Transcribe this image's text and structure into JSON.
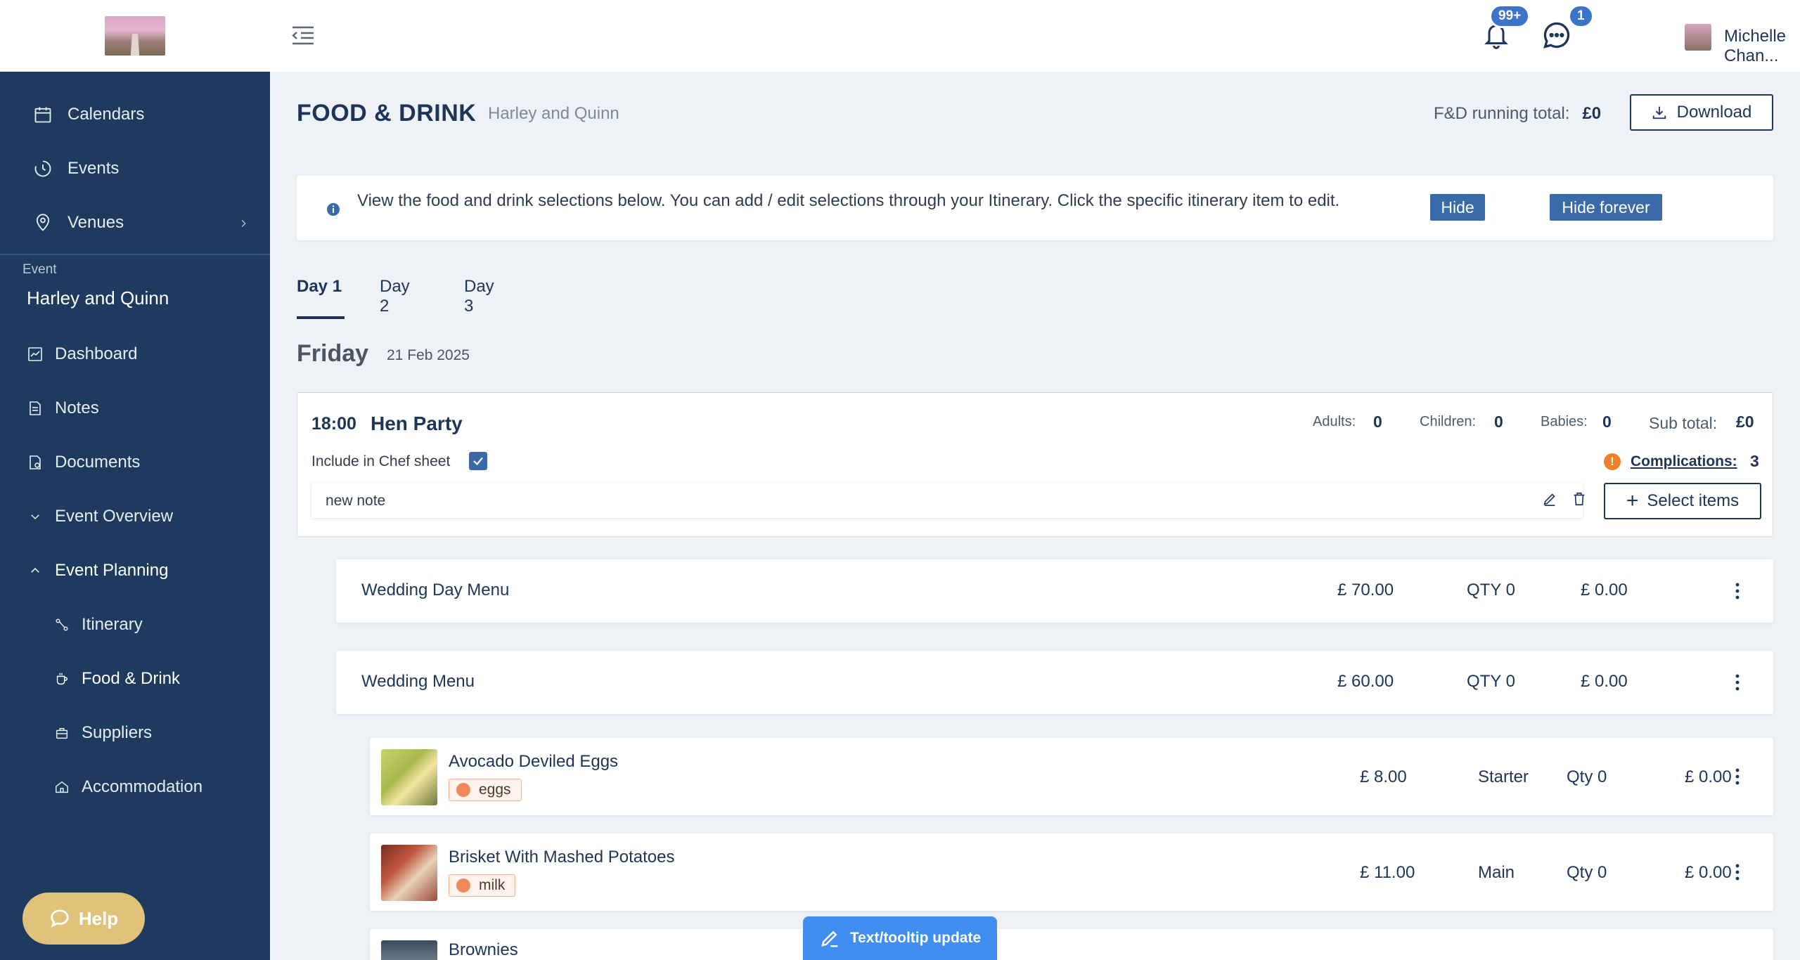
{
  "sidebar": {
    "nav": [
      {
        "label": "Calendars",
        "icon": "calendar-icon"
      },
      {
        "label": "Events",
        "icon": "history-icon"
      },
      {
        "label": "Venues",
        "icon": "location-pin-icon"
      }
    ],
    "event_label": "Event",
    "event_name": "Harley and Quinn",
    "event_nav": [
      {
        "label": "Dashboard"
      },
      {
        "label": "Notes"
      },
      {
        "label": "Documents"
      },
      {
        "label": "Event Overview"
      },
      {
        "label": "Event Planning"
      }
    ],
    "planning_sub": [
      {
        "label": "Itinerary"
      },
      {
        "label": "Food & Drink"
      },
      {
        "label": "Suppliers"
      },
      {
        "label": "Accommodation"
      }
    ],
    "help_label": "Help"
  },
  "topbar": {
    "notifications_badge": "99+",
    "messages_badge": "1",
    "username": "Michelle Chan..."
  },
  "page": {
    "title": "FOOD & DRINK",
    "subtitle": "Harley and Quinn",
    "running_total_label": "F&D running total:",
    "running_total_value": "£0",
    "download_label": "Download"
  },
  "info": {
    "text": "View the food and drink selections below. You can add / edit selections through your Itinerary. Click the specific itinerary item to edit.",
    "hide_label": "Hide",
    "hide_forever_label": "Hide forever"
  },
  "tabs": [
    "Day 1",
    "Day 2",
    "Day 3"
  ],
  "day": {
    "name": "Friday",
    "date": "21 Feb 2025"
  },
  "session": {
    "time": "18:00",
    "name": "Hen Party",
    "adults_label": "Adults:",
    "adults": "0",
    "children_label": "Children:",
    "children": "0",
    "babies_label": "Babies:",
    "babies": "0",
    "subtotal_label": "Sub total:",
    "subtotal": "£0",
    "chef_label": "Include in Chef sheet",
    "chef_checked": true,
    "complications_label": "Complications:",
    "complications": "3",
    "note": "new note",
    "select_label": "Select items"
  },
  "menus": [
    {
      "name": "Wedding Day Menu",
      "price": "£ 70.00",
      "qty": "QTY 0",
      "total": "£ 0.00"
    },
    {
      "name": "Wedding Menu",
      "price": "£ 60.00",
      "qty": "QTY 0",
      "total": "£ 0.00"
    }
  ],
  "items": [
    {
      "name": "Avocado Deviled Eggs",
      "allergen": "eggs",
      "price": "£ 8.00",
      "course": "Starter",
      "qty": "Qty 0",
      "total": "£ 0.00"
    },
    {
      "name": "Brisket With Mashed Potatoes",
      "allergen": "milk",
      "price": "£ 11.00",
      "course": "Main",
      "qty": "Qty 0",
      "total": "£ 0.00"
    },
    {
      "name": "Brownies"
    }
  ],
  "toast": {
    "label": "Text/tooltip update"
  },
  "colors": {
    "sidebar_bg": "#1e3a5f",
    "accent": "#3a6aa8",
    "help": "#e0c27a",
    "complication": "#f07f2a",
    "toast": "#3f8ef0"
  }
}
